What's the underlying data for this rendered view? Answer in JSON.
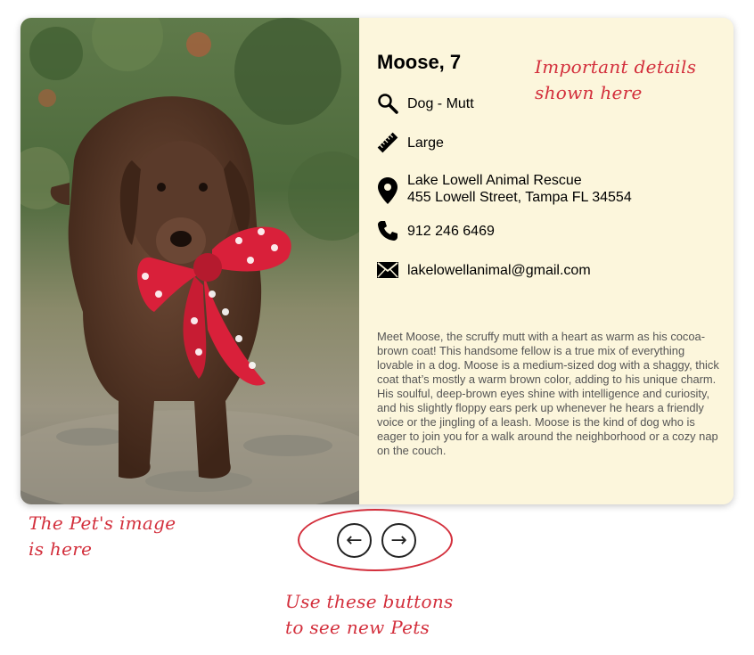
{
  "pet": {
    "name": "Moose, 7",
    "breed": "Dog - Mutt",
    "size": "Large",
    "shelter_name": "Lake Lowell Animal Rescue",
    "shelter_address": "455 Lowell Street, Tampa FL 34554",
    "phone": "912 246 6469",
    "email": "lakelowellanimal@gmail.com",
    "description": "Meet Moose, the scruffy mutt with a heart as warm as his cocoa-brown coat! This handsome fellow is a true mix of everything lovable in a dog. Moose is a medium-sized dog with a shaggy, thick coat that’s mostly a warm brown color, adding to his unique charm. His soulful, deep-brown eyes shine with intelligence and curiosity, and his slightly floppy ears perk up whenever he hears a friendly voice or the jingling of a leash. Moose is the kind of dog who is eager to join you for a walk around the neighborhood or a cozy nap on the couch."
  },
  "icons": {
    "breed": "search-icon",
    "size": "ruler-icon",
    "location": "map-pin-icon",
    "phone": "phone-icon",
    "email": "envelope-icon"
  },
  "nav": {
    "prev_label": "←",
    "next_label": "→"
  },
  "annotations": {
    "details_line1": "Important details",
    "details_line2": "shown here",
    "image_line1": "The Pet's image",
    "image_line2": "is here",
    "buttons_line1": "Use these buttons",
    "buttons_line2": "to see new Pets"
  },
  "colors": {
    "card_background": "#fcf6dc",
    "annotation": "#d32f3c",
    "bow": "#d9203a",
    "dog": "#5a3a2a"
  }
}
